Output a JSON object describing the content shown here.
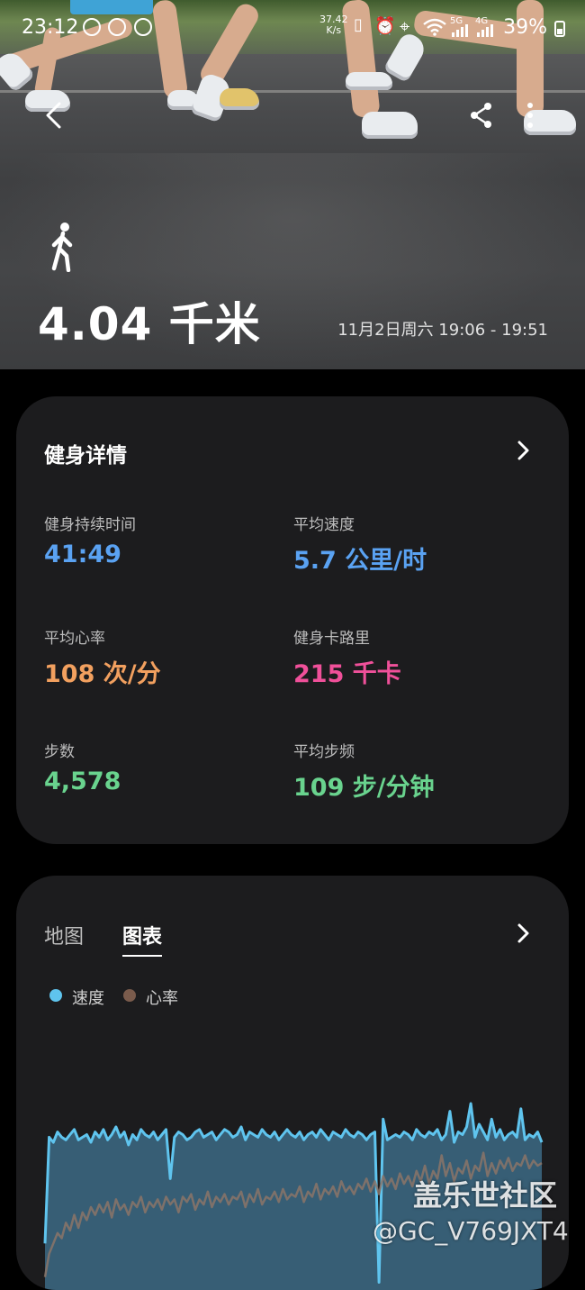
{
  "status_bar": {
    "time": "23:12",
    "network_speed_value": "37.42",
    "network_speed_unit": "K/s",
    "signal_5g": "5G",
    "signal_4g": "4G",
    "battery": "39%"
  },
  "hero": {
    "distance": "4.04 千米",
    "time_range": "11月2日周六 19:06 - 19:51"
  },
  "details_card": {
    "title": "健身详情",
    "metrics": [
      {
        "label": "健身持续时间",
        "value": "41:49",
        "color": "#5aa2f2"
      },
      {
        "label": "平均速度",
        "value": "5.7 公里/时",
        "color": "#5aa2f2"
      },
      {
        "label": "平均心率",
        "value": "108 次/分",
        "color": "#f2a05f"
      },
      {
        "label": "健身卡路里",
        "value": "215 千卡",
        "color": "#f0509a"
      },
      {
        "label": "步数",
        "value": "4,578",
        "color": "#69d38e"
      },
      {
        "label": "平均步频",
        "value": "109 步/分钟",
        "color": "#69d38e"
      }
    ]
  },
  "chart_card": {
    "tabs": [
      "地图",
      "图表"
    ],
    "active_tab": "图表",
    "legend": [
      {
        "label": "速度",
        "color": "#5fc4ee"
      },
      {
        "label": "心率",
        "color": "#7a5b4c"
      }
    ]
  },
  "chart_data": {
    "type": "area",
    "series": [
      {
        "name": "速度",
        "color": "#5fc4ee",
        "values": [
          1.8,
          5.9,
          5.7,
          6.1,
          5.9,
          5.8,
          6.0,
          6.2,
          5.8,
          5.9,
          6.0,
          5.7,
          6.1,
          5.9,
          6.2,
          5.8,
          6.0,
          6.3,
          5.9,
          6.1,
          5.6,
          6.0,
          5.8,
          6.2,
          6.0,
          5.9,
          6.1,
          5.8,
          6.0,
          6.2,
          4.3,
          5.9,
          6.1,
          6.0,
          5.8,
          5.9,
          6.1,
          6.2,
          5.9,
          6.0,
          6.1,
          5.8,
          6.0,
          6.2,
          6.1,
          5.9,
          6.0,
          6.3,
          5.8,
          6.1,
          6.0,
          5.9,
          6.2,
          6.0,
          5.9,
          6.1,
          5.8,
          6.0,
          6.2,
          6.0,
          5.9,
          6.1,
          5.8,
          6.0,
          6.1,
          5.9,
          6.2,
          6.0,
          5.8,
          6.1,
          6.0,
          5.9,
          6.2,
          6.0,
          5.9,
          6.1,
          6.0,
          5.8,
          6.0,
          6.1,
          0.3,
          6.6,
          5.8,
          5.9,
          6.0,
          5.9,
          6.1,
          6.0,
          5.8,
          6.2,
          6.0,
          5.9,
          6.1,
          6.0,
          6.2,
          5.8,
          6.0,
          6.9,
          5.7,
          6.1,
          6.0,
          6.3,
          7.2,
          5.9,
          6.4,
          6.1,
          5.8,
          6.6,
          5.9,
          6.2,
          5.8,
          6.0,
          6.1,
          5.9,
          7.0,
          5.8,
          6.0,
          5.9,
          6.1,
          5.7
        ]
      },
      {
        "name": "心率",
        "color": "#7a5b4c",
        "values": [
          0.5,
          1.4,
          1.8,
          2.2,
          2.0,
          2.6,
          2.3,
          2.9,
          2.4,
          3.0,
          2.7,
          3.2,
          2.9,
          3.3,
          3.0,
          3.4,
          2.8,
          3.5,
          3.1,
          3.3,
          2.9,
          3.4,
          3.2,
          3.6,
          3.0,
          3.4,
          3.2,
          3.5,
          3.1,
          3.6,
          3.3,
          3.5,
          3.0,
          3.6,
          3.4,
          3.7,
          3.1,
          3.5,
          3.3,
          3.8,
          3.2,
          3.6,
          3.4,
          3.7,
          3.3,
          3.6,
          3.5,
          3.8,
          3.2,
          3.7,
          3.4,
          3.9,
          3.3,
          3.6,
          3.5,
          3.8,
          3.4,
          3.9,
          3.5,
          3.7,
          3.6,
          4.0,
          3.4,
          3.8,
          3.6,
          4.1,
          3.5,
          3.9,
          3.7,
          4.0,
          3.6,
          4.2,
          3.8,
          4.0,
          3.7,
          4.1,
          3.9,
          4.3,
          3.8,
          4.2,
          3.7,
          4.4,
          4.0,
          4.3,
          3.9,
          4.5,
          4.1,
          4.4,
          4.0,
          4.6,
          4.2,
          4.8,
          4.1,
          4.6,
          4.3,
          5.2,
          4.4,
          4.9,
          4.2,
          4.7,
          4.5,
          5.0,
          4.3,
          4.8,
          4.6,
          5.3,
          4.4,
          4.9,
          4.5,
          5.0,
          4.7,
          5.1,
          4.6,
          4.9,
          4.8,
          5.2,
          4.7,
          5.0,
          4.8,
          4.9
        ]
      }
    ]
  },
  "watermark": {
    "line1": "盖乐世社区",
    "line2": "@GC_V769JXT4"
  }
}
